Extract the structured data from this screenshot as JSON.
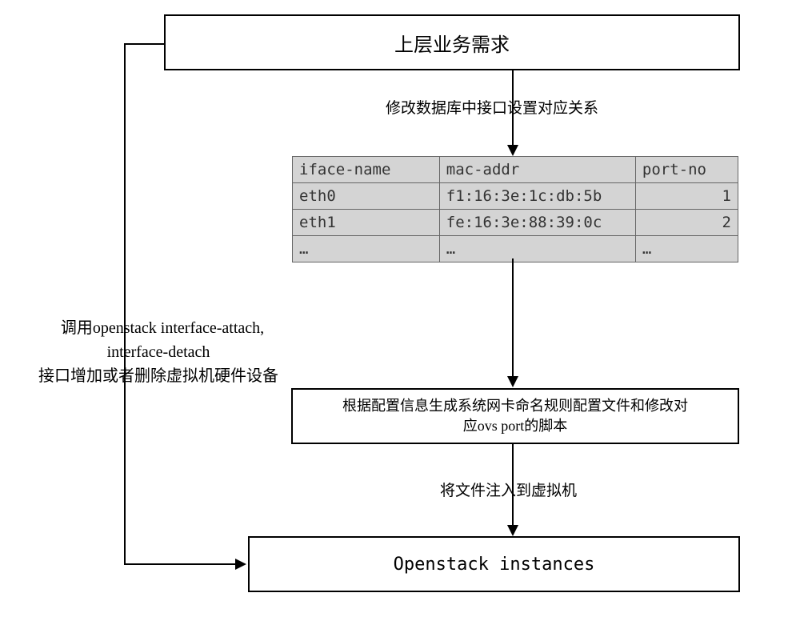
{
  "top_box": "上层业务需求",
  "label_top_arrow": "修改数据库中接口设置对应关系",
  "table": {
    "headers": [
      "iface-name",
      "mac-addr",
      "port-no"
    ],
    "rows": [
      [
        "eth0",
        "f1:16:3e:1c:db:5b",
        "1"
      ],
      [
        "eth1",
        "fe:16:3e:88:39:0c",
        "2"
      ],
      [
        "…",
        "…",
        "…"
      ]
    ]
  },
  "middle_box": "根据配置信息生成系统网卡命名规则配置文件和修改对\n应ovs port的脚本",
  "label_mid_arrow": "将文件注入到虚拟机",
  "bottom_box": "Openstack instances",
  "left_label": "调用openstack interface-attach,\ninterface-detach\n接口增加或者删除虚拟机硬件设备"
}
